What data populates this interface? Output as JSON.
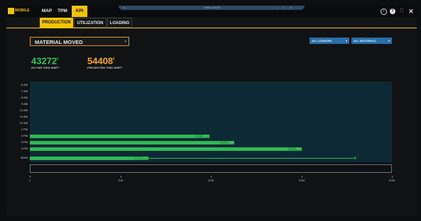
{
  "app": {
    "logo_text": "MOBILE"
  },
  "nav": {
    "tabs": [
      {
        "label": "MAP",
        "active": false
      },
      {
        "label": "TPM",
        "active": false
      },
      {
        "label": "KPI",
        "active": true
      }
    ]
  },
  "ribbon": {
    "center_text": "SIMULATOR"
  },
  "top_icons": [
    "info-circle-icon",
    "help-icon",
    "fullscreen-icon",
    "close-icon"
  ],
  "subtabs": [
    {
      "label": "PRODUCTION",
      "active": true
    },
    {
      "label": "UTILIZATION",
      "active": false
    },
    {
      "label": "LOADING",
      "active": false
    }
  ],
  "metric_select": {
    "selected": "MATERIAL MOVED"
  },
  "filters": {
    "loaders": "ALL LOADERS",
    "materials": "ALL MATERIALS"
  },
  "stats": {
    "so_far": {
      "value": "43272",
      "unit": "t",
      "label": "SO FAR THIS SHIFT",
      "color": "#35c45c"
    },
    "projected": {
      "value": "54408",
      "unit": "t",
      "label": "PROJECTED THIS SHIFT",
      "color": "#f5a623"
    }
  },
  "colors": {
    "accent": "#f5c400",
    "bar": "#2fb853",
    "chart_bg": "#0c2935",
    "filter_btn": "#2a6ea8",
    "now_label": "#6fb3e6"
  },
  "chart_data": {
    "type": "bar",
    "orientation": "horizontal",
    "categories": [
      "6 AM",
      "7 AM",
      "8 AM",
      "9 AM",
      "10 AM",
      "11 AM",
      "12 AM",
      "1 PM",
      "2 PM",
      "3 PM",
      "4 PM",
      "NOW"
    ],
    "values": [
      0,
      0,
      0,
      0,
      0,
      0,
      0,
      0,
      21300,
      24300,
      32300,
      14100
    ],
    "value_labels": [
      "",
      "",
      "",
      "",
      "",
      "",
      "",
      "",
      "21,3",
      "24,3",
      "32,3",
      "14,1"
    ],
    "target": {
      "category": "NOW",
      "value": 38600
    },
    "xlim": [
      0,
      43000
    ],
    "xticks": [
      0,
      10800,
      21500,
      32300,
      43000
    ],
    "xtick_labels": [
      "0",
      "5,80",
      "10,80",
      "15,80",
      "20,80"
    ],
    "title": "",
    "xlabel": "",
    "ylabel": ""
  }
}
